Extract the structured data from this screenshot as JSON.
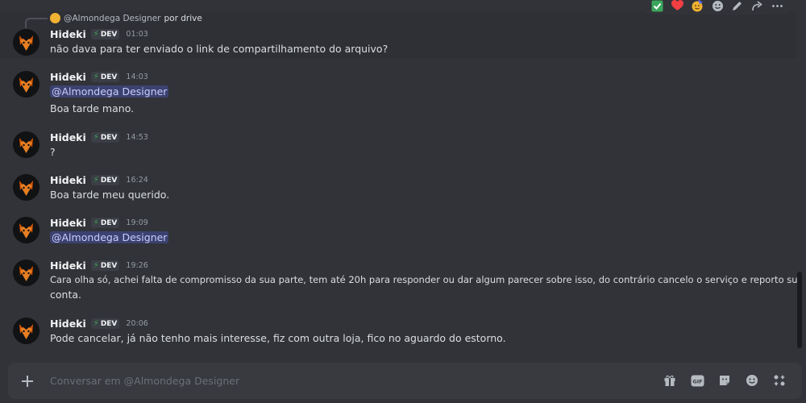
{
  "reply": {
    "name": "@Almondega Designer",
    "text": "por drive"
  },
  "toolbar": {
    "icons": [
      "check-emoji",
      "heart-emoji",
      "party-face-emoji",
      "add-reaction-icon",
      "edit-icon",
      "forward-icon",
      "more-icon"
    ]
  },
  "messages": [
    {
      "author": "Hideki",
      "tag": "DEV",
      "time": "01:03",
      "lines": [
        "não dava para ter enviado o link de compartilhamento do arquivo?"
      ]
    },
    {
      "author": "Hideki",
      "tag": "DEV",
      "time": "14:03",
      "mention": "@Almondega Designer",
      "lines": [
        "Boa tarde mano."
      ]
    },
    {
      "author": "Hideki",
      "tag": "DEV",
      "time": "14:53",
      "lines": [
        "?"
      ]
    },
    {
      "author": "Hideki",
      "tag": "DEV",
      "time": "16:24",
      "lines": [
        "Boa tarde meu querido."
      ]
    },
    {
      "author": "Hideki",
      "tag": "DEV",
      "time": "19:09",
      "mention": "@Almondega Designer"
    },
    {
      "author": "Hideki",
      "tag": "DEV",
      "time": "19:26",
      "lines": [
        "Cara olha só, achei falta de compromisso da sua parte, tem até 20h para responder ou dar algum parecer sobre isso, do contrário cancelo o serviço e reporto sua",
        "conta."
      ]
    },
    {
      "author": "Hideki",
      "tag": "DEV",
      "time": "20:06",
      "lines": [
        "Pode cancelar, já não tenho mais interesse, fiz com outra loja, fico no aguardo do estorno."
      ]
    }
  ],
  "input": {
    "placeholder": "Conversar em @Almondega Designer"
  },
  "colors": {
    "background": "#313338",
    "input": "#383a40",
    "mention_bg": "#3c4270",
    "tag_bolt": "#3ba55c"
  }
}
